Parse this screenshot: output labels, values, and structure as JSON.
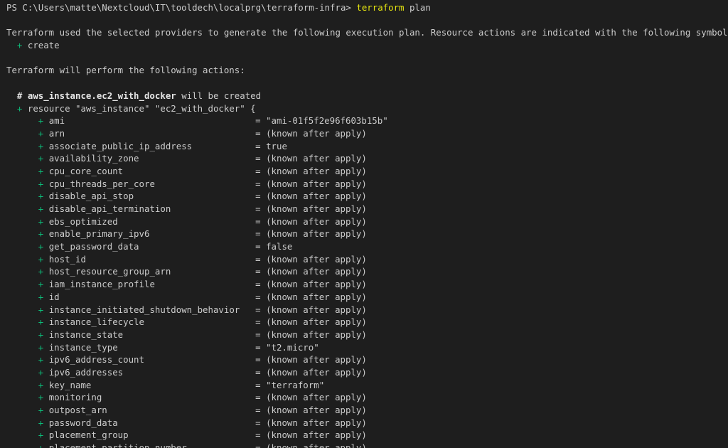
{
  "prompt": {
    "path": "PS C:\\Users\\matte\\Nextcloud\\IT\\tooldech\\localprg\\terraform-infra>",
    "command": "terraform",
    "argument": "plan"
  },
  "intro": {
    "line1": "Terraform used the selected providers to generate the following execution plan. Resource actions are indicated with the following symbols:",
    "create_symbol": "+",
    "create_label": "create",
    "line2": "Terraform will perform the following actions:"
  },
  "resource": {
    "comment_hash": "#",
    "address": "aws_instance.ec2_with_docker",
    "comment_suffix": "will be created",
    "plus": "+",
    "header": "resource \"aws_instance\" \"ec2_with_docker\" {"
  },
  "colors": {
    "background": "#1e1e1e",
    "text": "#cccccc",
    "command": "#e5e510",
    "plus": "#0dbc79"
  },
  "attributes": [
    {
      "name": "ami",
      "value": "\"ami-01f5f2e96f603b15b\""
    },
    {
      "name": "arn",
      "value": "(known after apply)"
    },
    {
      "name": "associate_public_ip_address",
      "value": "true"
    },
    {
      "name": "availability_zone",
      "value": "(known after apply)"
    },
    {
      "name": "cpu_core_count",
      "value": "(known after apply)"
    },
    {
      "name": "cpu_threads_per_core",
      "value": "(known after apply)"
    },
    {
      "name": "disable_api_stop",
      "value": "(known after apply)"
    },
    {
      "name": "disable_api_termination",
      "value": "(known after apply)"
    },
    {
      "name": "ebs_optimized",
      "value": "(known after apply)"
    },
    {
      "name": "enable_primary_ipv6",
      "value": "(known after apply)"
    },
    {
      "name": "get_password_data",
      "value": "false"
    },
    {
      "name": "host_id",
      "value": "(known after apply)"
    },
    {
      "name": "host_resource_group_arn",
      "value": "(known after apply)"
    },
    {
      "name": "iam_instance_profile",
      "value": "(known after apply)"
    },
    {
      "name": "id",
      "value": "(known after apply)"
    },
    {
      "name": "instance_initiated_shutdown_behavior",
      "value": "(known after apply)"
    },
    {
      "name": "instance_lifecycle",
      "value": "(known after apply)"
    },
    {
      "name": "instance_state",
      "value": "(known after apply)"
    },
    {
      "name": "instance_type",
      "value": "\"t2.micro\""
    },
    {
      "name": "ipv6_address_count",
      "value": "(known after apply)"
    },
    {
      "name": "ipv6_addresses",
      "value": "(known after apply)"
    },
    {
      "name": "key_name",
      "value": "\"terraform\""
    },
    {
      "name": "monitoring",
      "value": "(known after apply)"
    },
    {
      "name": "outpost_arn",
      "value": "(known after apply)"
    },
    {
      "name": "password_data",
      "value": "(known after apply)"
    },
    {
      "name": "placement_group",
      "value": "(known after apply)"
    },
    {
      "name": "placement_partition_number",
      "value": "(known after apply)"
    }
  ]
}
